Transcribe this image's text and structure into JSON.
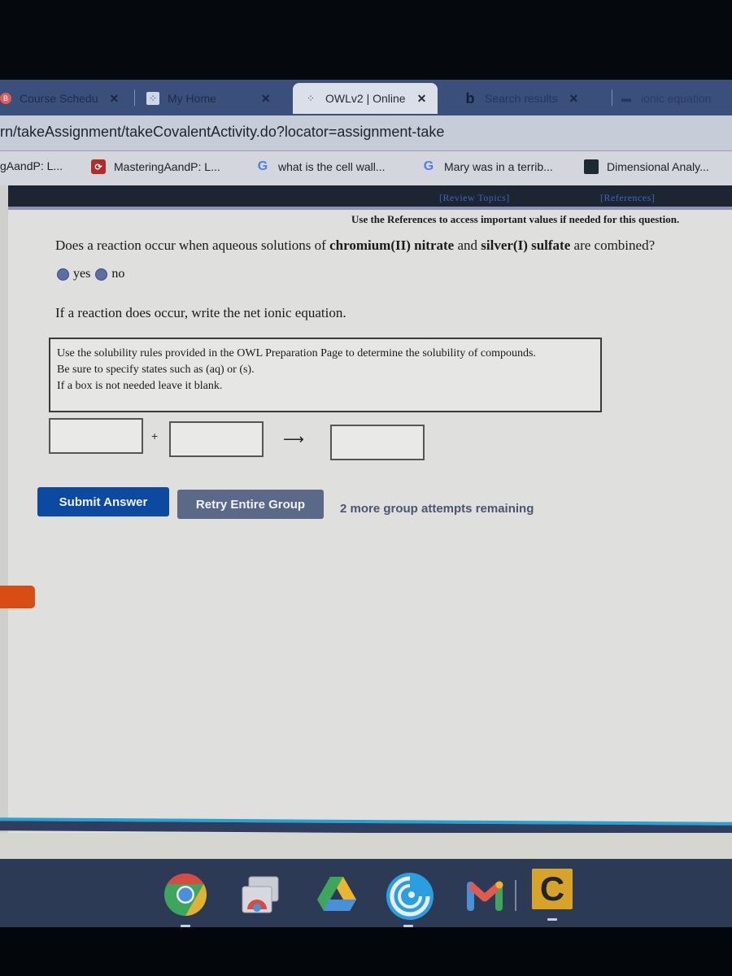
{
  "browser": {
    "tabs": [
      {
        "label": "Course Schedu",
        "icon": "course-schedule-icon",
        "active": false,
        "closable": true
      },
      {
        "label": "My Home",
        "icon": "owl-icon",
        "active": false,
        "closable": true
      },
      {
        "label": "OWLv2 | Online",
        "icon": "owl-icon",
        "active": true,
        "closable": true
      },
      {
        "label": "Search results",
        "icon": "bing-icon",
        "active": false,
        "closable": true
      },
      {
        "label": "ionic equation",
        "icon": "page-icon",
        "active": false,
        "closable": false
      }
    ],
    "url": "rn/takeAssignment/takeCovalentActivity.do?locator=assignment-take",
    "bookmarks": [
      {
        "label": "gAandP: L...",
        "icon": "none"
      },
      {
        "label": "MasteringAandP: L...",
        "icon": "mastering-icon"
      },
      {
        "label": "what is the cell wall...",
        "icon": "google-icon"
      },
      {
        "label": "Mary was in a terrib...",
        "icon": "google-icon"
      },
      {
        "label": "Dimensional Analy...",
        "icon": "dimensional-icon"
      }
    ],
    "close_glyph": "✕",
    "google_glyph": "G",
    "mastering_glyph": "⟳",
    "bing_glyph": "b"
  },
  "owl": {
    "header_links": {
      "review_topics": "[Review Topics]",
      "references": "[References]"
    },
    "reference_note": "Use the References to access important values if needed for this question.",
    "question": {
      "prefix": "Does a reaction occur when aqueous solutions of ",
      "reactant1": "chromium(II) nitrate",
      "middle": " and ",
      "reactant2": "silver(I) sulfate",
      "suffix": " are combined?"
    },
    "options": [
      {
        "label": "yes",
        "selected": false
      },
      {
        "label": "no",
        "selected": false
      }
    ],
    "instruction": "If a reaction does occur, write the net ionic equation.",
    "rules": [
      "Use the solubility rules provided in the OWL Preparation Page to determine the solubility of compounds.",
      "Be sure to specify states such as (aq) or (s).",
      "If a box is not needed leave it blank."
    ],
    "equation": {
      "reactant1_value": "",
      "reactant2_value": "",
      "product_value": "",
      "plus": "+",
      "arrow": "⟶"
    },
    "buttons": {
      "submit": "Submit Answer",
      "retry": "Retry Entire Group"
    },
    "attempts_text": "2 more group attempts remaining"
  },
  "shelf": {
    "apps": [
      {
        "name": "chrome",
        "running": true
      },
      {
        "name": "chrome-app-windows",
        "running": false
      },
      {
        "name": "google-drive",
        "running": false
      },
      {
        "name": "files-circle",
        "running": true
      },
      {
        "name": "gmail",
        "running": false
      },
      {
        "name": "c-app",
        "running": true
      }
    ],
    "c_app_glyph": "C",
    "colors": {
      "accent": "#27a2d4",
      "shelf": "#2d3a55"
    }
  },
  "colors": {
    "submit_button": "#0b4aa0",
    "retry_button": "#5b6988",
    "radio": "#5d6ea3",
    "link": "#3d64c8",
    "orange_tab": "#d84d14"
  }
}
